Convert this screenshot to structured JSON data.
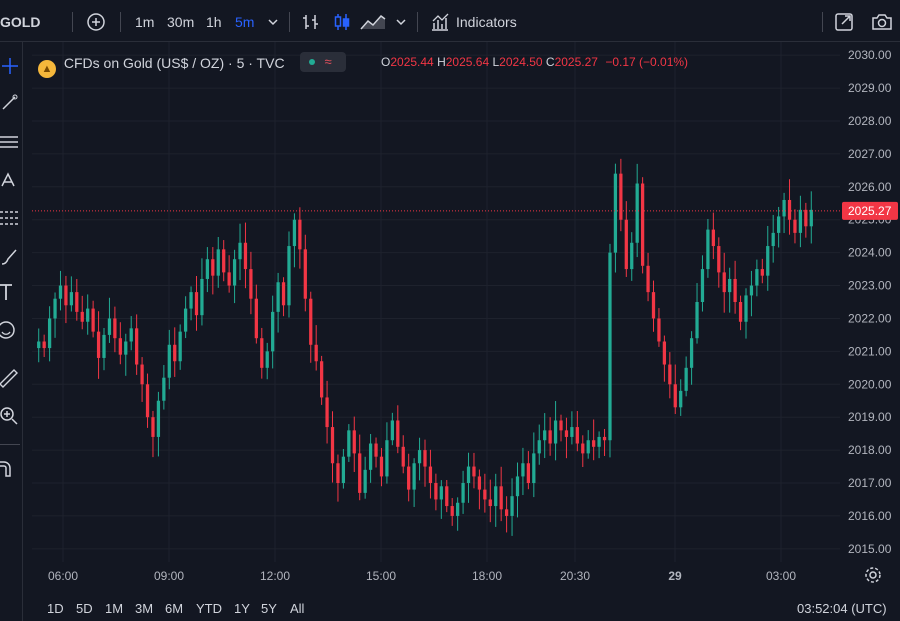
{
  "toolbar": {
    "symbol": "GOLD",
    "intervals": [
      "1m",
      "30m",
      "1h",
      "5m"
    ],
    "active_interval": "5m",
    "indicators_label": "Indicators"
  },
  "legend": {
    "title": "CFDs on Gold (US$ / OZ) · 5 · TVC",
    "open_label": "O",
    "open": "2025.44",
    "high_label": "H",
    "high": "2025.64",
    "low_label": "L",
    "low": "2024.50",
    "close_label": "C",
    "close": "2025.27",
    "change": "−0.17 (−0.01%)"
  },
  "price_axis": {
    "ticks": [
      "2030.00",
      "2029.00",
      "2028.00",
      "2027.00",
      "2026.00",
      "2025.00",
      "2024.00",
      "2023.00",
      "2022.00",
      "2021.00",
      "2020.00",
      "2019.00",
      "2018.00",
      "2017.00",
      "2016.00",
      "2015.00"
    ],
    "current_price": "2025.27"
  },
  "time_axis": {
    "ticks": [
      "06:00",
      "09:00",
      "12:00",
      "15:00",
      "18:00",
      "20:30",
      "29",
      "03:00"
    ]
  },
  "bottom_bar": {
    "ranges": [
      "1D",
      "5D",
      "1M",
      "3M",
      "6M",
      "YTD",
      "1Y",
      "5Y",
      "All"
    ],
    "clock": "03:52:04 (UTC)"
  },
  "colors": {
    "up": "#22ab94",
    "down": "#f23645",
    "background": "#131722",
    "accent": "#2962ff"
  },
  "chart_data": {
    "type": "candlestick",
    "ylim": [
      2014.6,
      2030.4
    ],
    "close_series": [
      2021.3,
      2021.1,
      2022.0,
      2022.6,
      2023.0,
      2022.4,
      2022.8,
      2022.2,
      2021.9,
      2022.3,
      2021.6,
      2020.8,
      2021.5,
      2022.0,
      2021.4,
      2020.9,
      2021.3,
      2021.7,
      2020.6,
      2020.0,
      2019.0,
      2018.4,
      2019.5,
      2020.2,
      2021.2,
      2020.7,
      2021.6,
      2022.3,
      2022.8,
      2022.1,
      2023.2,
      2023.8,
      2023.3,
      2024.1,
      2023.4,
      2023.0,
      2023.8,
      2024.3,
      2023.5,
      2022.6,
      2021.4,
      2020.5,
      2021.0,
      2022.2,
      2023.1,
      2022.4,
      2024.2,
      2025.0,
      2024.1,
      2022.6,
      2021.2,
      2020.7,
      2019.6,
      2018.7,
      2017.6,
      2017.0,
      2017.8,
      2018.6,
      2017.9,
      2016.7,
      2017.4,
      2018.2,
      2017.8,
      2017.2,
      2018.3,
      2018.9,
      2018.1,
      2017.5,
      2016.8,
      2017.6,
      2018.0,
      2017.5,
      2017.0,
      2016.5,
      2016.9,
      2016.3,
      2016.0,
      2016.4,
      2017.0,
      2017.5,
      2017.2,
      2016.8,
      2016.5,
      2016.3,
      2016.9,
      2016.2,
      2016.0,
      2016.6,
      2017.2,
      2017.6,
      2017.0,
      2017.9,
      2018.3,
      2018.6,
      2018.2,
      2018.9,
      2018.6,
      2018.4,
      2018.7,
      2018.2,
      2017.9,
      2018.3,
      2018.1,
      2018.4,
      2018.3,
      2024.0,
      2026.4,
      2025.0,
      2023.5,
      2024.3,
      2026.1,
      2023.6,
      2022.8,
      2022.0,
      2021.3,
      2020.6,
      2020.0,
      2019.3,
      2019.8,
      2020.5,
      2021.4,
      2022.5,
      2023.5,
      2024.7,
      2024.2,
      2023.4,
      2022.8,
      2023.2,
      2022.5,
      2021.9,
      2022.7,
      2023.0,
      2023.5,
      2023.3,
      2024.2,
      2024.6,
      2025.1,
      2025.6,
      2025.0,
      2024.6,
      2025.3,
      2024.8,
      2025.3
    ]
  }
}
